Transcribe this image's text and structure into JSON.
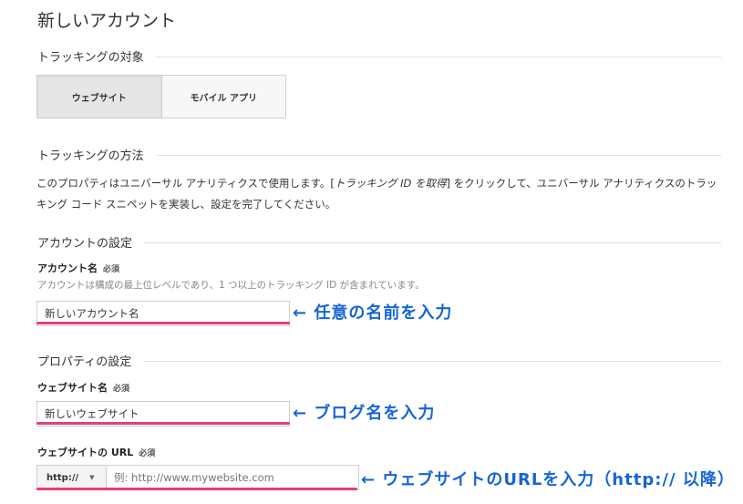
{
  "page": {
    "title": "新しいアカウント"
  },
  "tracking_target": {
    "heading": "トラッキングの対象",
    "options": [
      {
        "label": "ウェブサイト",
        "selected": true
      },
      {
        "label": "モバイル アプリ",
        "selected": false
      }
    ]
  },
  "tracking_method": {
    "heading": "トラッキングの方法",
    "desc_before": "このプロパティはユニバーサル アナリティクスで使用します。[",
    "desc_link": "トラッキング ID を取得",
    "desc_after": "] をクリックして、ユニバーサル アナリティクスのトラッキング コード スニペットを実装し、設定を完了してください。"
  },
  "account_settings": {
    "heading": "アカウントの設定",
    "name_label": "アカウント名",
    "required": "必須",
    "hint": "アカウントは構成の最上位レベルであり、1 つ以上のトラッキング ID が含まれています。",
    "name_value": "新しいアカウント名",
    "annotation": "← 任意の名前を入力"
  },
  "property_settings": {
    "heading": "プロパティの設定",
    "site_name_label": "ウェブサイト名",
    "required": "必須",
    "site_name_value": "新しいウェブサイト",
    "site_name_annotation": "← ブログ名を入力",
    "url_label": "ウェブサイトの URL",
    "url_required": "必須",
    "protocol": "http://",
    "url_placeholder": "例: http://www.mywebsite.com",
    "url_annotation": "← ウェブサイトのURLを入力（http:// 以降）"
  },
  "colors": {
    "annotation": "#1565d8",
    "underline": "#e63f6f"
  }
}
